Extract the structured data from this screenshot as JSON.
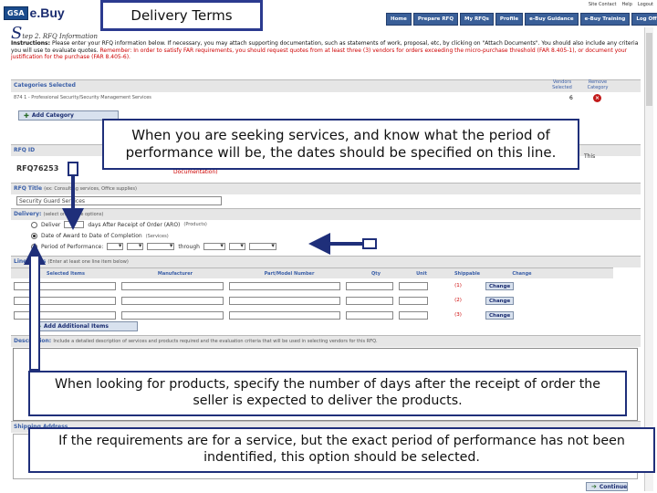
{
  "header": {
    "logo_badge": "GSA",
    "logo_text": "e.Buy",
    "slide_title": "Delivery Terms",
    "top_links": [
      "Site Contact",
      "Help",
      "Logout"
    ],
    "nav": [
      "Home",
      "Prepare RFQ",
      "My RFQs",
      "Profile",
      "e-Buy Guidance",
      "e-Buy Training",
      "Log Off"
    ]
  },
  "step": {
    "letter": "S",
    "title": "tep 2. RFQ Information"
  },
  "instructions": {
    "label": "Instructions:",
    "text": "Please enter your RFQ information below. If necessary, you may attach supporting documentation, such as statements of work, proposal, etc, by clicking on \"Attach Documents\". You should also include any criteria you will use to evaluate quotes.",
    "reminder": "Remember: In order to satisfy FAR requirements, you should request quotes from at least three (3) vendors for orders exceeding the micro-purchase threshold (FAR 8.405-1), or document your justification for the purchase (FAR 8.405-6)."
  },
  "categories": {
    "header": "Categories Selected",
    "row": "874 1 - Professional Security/Security Management Services",
    "vendors_label": "Vendors Selected",
    "remove_label": "Remove Category",
    "vendors_count": "6",
    "remove_icon": "x-icon",
    "add_button": "Add Category"
  },
  "rfq_id": {
    "header": "RFQ ID",
    "value": "RFQ76253",
    "this_text": "This",
    "doc_info": "Documentation)"
  },
  "rfq_title": {
    "header": "RFQ Title",
    "hint": "(ex: Consulting services, Office supplies)",
    "value": "Security Guard Services"
  },
  "delivery": {
    "header": "Delivery:",
    "hint": "(select one of the options)",
    "option1_pre": "Deliver",
    "option1_post": "days After Receipt of Order (ARO)",
    "option1_hint": "(Products)",
    "option2": "Date of Award to Date of Completion",
    "option2_hint": "(Services)",
    "option3_pre": "Period of Performance:",
    "option3_through": "through"
  },
  "line_items": {
    "header": "Line Items",
    "hint": "(Enter at least one line item below)",
    "columns": [
      "Selected Items",
      "Manufacturer",
      "Part/Model Number",
      "Qty",
      "Unit",
      "Shippable",
      "Change"
    ],
    "rows": [
      {
        "num": "(1)",
        "action": "Change"
      },
      {
        "num": "(2)",
        "action": "Change"
      },
      {
        "num": "(3)",
        "action": "Change"
      }
    ],
    "add_button": "Add Additional Items"
  },
  "description": {
    "header": "Description:",
    "hint": "Include a detailed description of services and products required and the evaluation criteria that will be used in selecting vendors for this RFQ."
  },
  "shipping": {
    "header": "Shipping Address"
  },
  "continue_button": "Continue",
  "callouts": {
    "services_dates": "When you are seeking services, and know what the period of performance will be, the dates should be specified on this line.",
    "products_days": "When looking for products, specify the number of days after the receipt of order the seller is expected to deliver the products.",
    "service_unknown": "If the requirements are for a service, but the exact period of performance has not been indentified, this option should be selected."
  },
  "colors": {
    "accent": "#1f2f7a",
    "nav": "#3a5f98",
    "alert": "#c00000"
  }
}
